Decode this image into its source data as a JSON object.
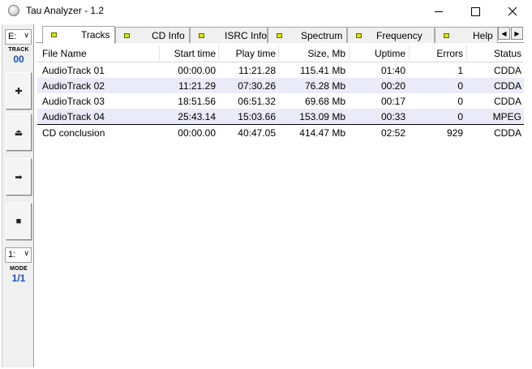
{
  "window": {
    "title": "Tau Analyzer - 1.2"
  },
  "toolbar": {
    "drive_value": "E:",
    "track_label": "TRACK",
    "track_value": "00",
    "buttons": [
      {
        "name": "add-icon",
        "glyph": "✚"
      },
      {
        "name": "eject-icon",
        "glyph": "⏏"
      },
      {
        "name": "play-icon",
        "glyph": "➡"
      },
      {
        "name": "stop-icon",
        "glyph": "■"
      }
    ],
    "mode_select_value": "1:",
    "mode_label": "MODE",
    "mode_value": "1/1"
  },
  "tabs": [
    "Tracks",
    "CD Info",
    "ISRC Info",
    "Spectrum",
    "Frequency",
    "Help"
  ],
  "active_tab": "Tracks",
  "table": {
    "columns": [
      "File Name",
      "Start time",
      "Play time",
      "Size, Mb",
      "Uptime",
      "Errors",
      "Status"
    ],
    "rows": [
      [
        "AudioTrack 01",
        "00:00.00",
        "11:21.28",
        "115.41 Mb",
        "01:40",
        "1",
        "CDDA"
      ],
      [
        "AudioTrack 02",
        "11:21.29",
        "07:30.26",
        "76.28 Mb",
        "00:20",
        "0",
        "CDDA"
      ],
      [
        "AudioTrack 03",
        "18:51.56",
        "06:51.32",
        "69.68 Mb",
        "00:17",
        "0",
        "CDDA"
      ],
      [
        "AudioTrack 04",
        "25:43.14",
        "15:03.66",
        "153.09 Mb",
        "00:33",
        "0",
        "MPEG"
      ]
    ],
    "summary": [
      "CD conclusion",
      "00:00.00",
      "40:47.05",
      "414.47 Mb",
      "02:52",
      "929",
      "CDDA"
    ]
  },
  "colors": {
    "row_alt": "#eaeaf8",
    "tab_flag": "#d8e800",
    "mini_value": "#1d4fd0"
  }
}
